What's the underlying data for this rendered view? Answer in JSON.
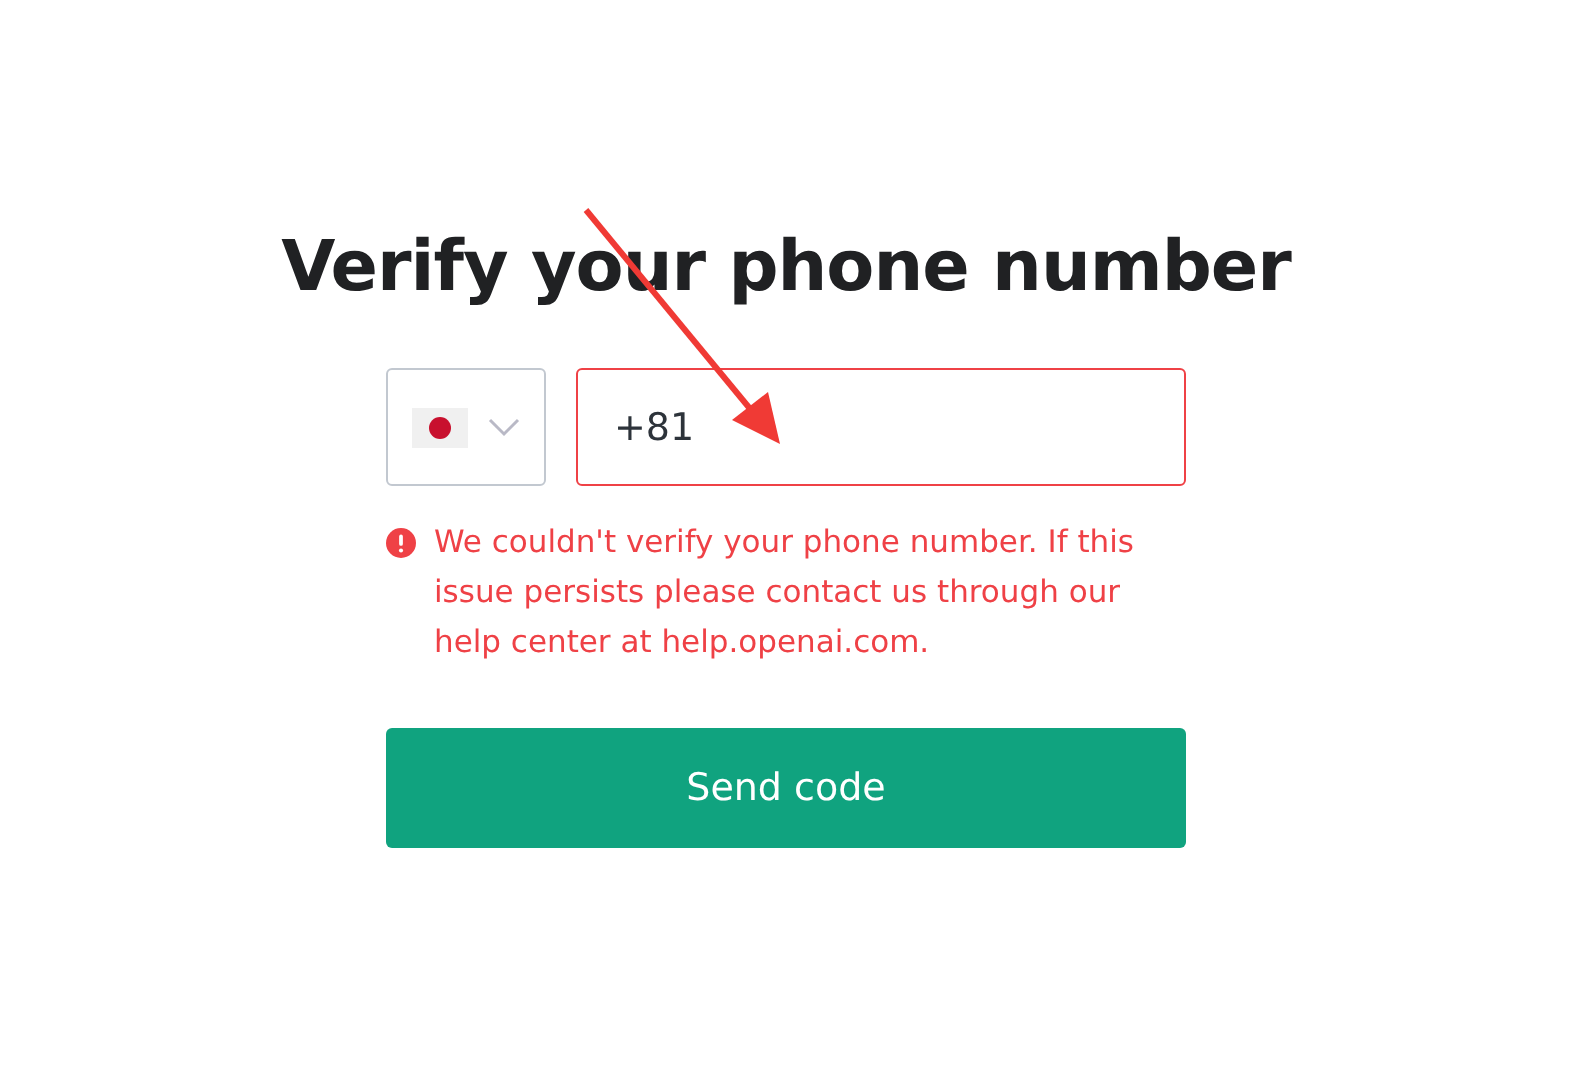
{
  "title": "Verify your phone number",
  "phone_field": {
    "value": "+81",
    "invalid": true
  },
  "error_message": "We couldn't verify your phone number. If this issue persists please contact us through our help center at help.openai.com.",
  "send_button": {
    "label": "Send code"
  }
}
